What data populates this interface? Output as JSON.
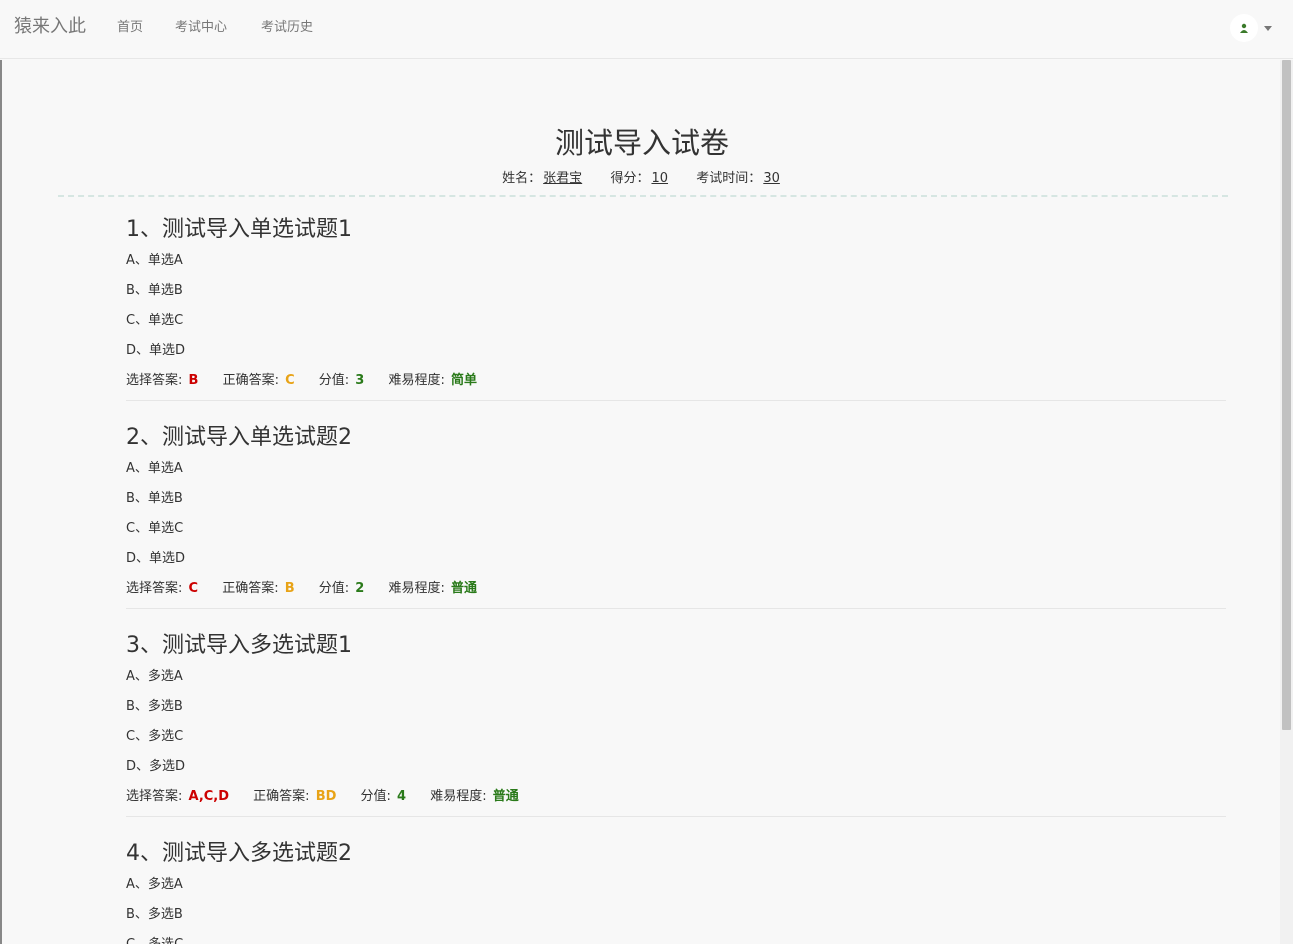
{
  "nav": {
    "brand": "猿来入此",
    "items": [
      "首页",
      "考试中心",
      "考试历史"
    ]
  },
  "exam": {
    "title": "测试导入试卷",
    "name_label": "姓名：",
    "name": "张君宝",
    "score_label": "得分：",
    "score": "10",
    "time_label": "考试时间：",
    "time": "30"
  },
  "labels": {
    "selected": "选择答案: ",
    "correct": "正确答案: ",
    "points": "分值: ",
    "difficulty": "难易程度: "
  },
  "questions": [
    {
      "title": "1、测试导入单选试题1",
      "options": [
        "A、单选A",
        "B、单选B",
        "C、单选C",
        "D、单选D"
      ],
      "selected": "B",
      "correct": "C",
      "points": "3",
      "difficulty": "简单"
    },
    {
      "title": "2、测试导入单选试题2",
      "options": [
        "A、单选A",
        "B、单选B",
        "C、单选C",
        "D、单选D"
      ],
      "selected": "C",
      "correct": "B",
      "points": "2",
      "difficulty": "普通"
    },
    {
      "title": "3、测试导入多选试题1",
      "options": [
        "A、多选A",
        "B、多选B",
        "C、多选C",
        "D、多选D"
      ],
      "selected": "A,C,D",
      "correct": "BD",
      "points": "4",
      "difficulty": "普通"
    },
    {
      "title": "4、测试导入多选试题2",
      "options": [
        "A、多选A",
        "B、多选B",
        "C、多选C"
      ]
    }
  ],
  "colors": {
    "selected": "#cc0000",
    "correct": "#e8a317",
    "points": "#2a7a1a",
    "difficulty": "#2a7a1a"
  }
}
